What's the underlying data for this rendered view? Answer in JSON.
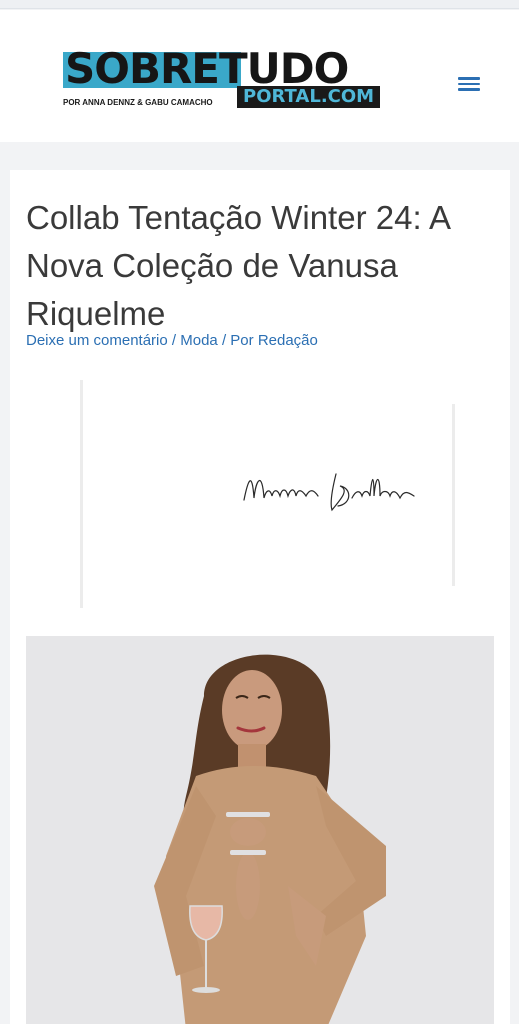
{
  "header": {
    "logo_word": "SOBRETUDO",
    "logo_portal": "PORTAL.COM",
    "logo_byline": "POR ANNA DENNZ & GABU CAMACHO",
    "menu_icon": "hamburger-menu-icon"
  },
  "article": {
    "title": "Collab Tentação Winter 24: A Nova Coleção de Vanusa Riquelme",
    "meta": {
      "comment_link": "Deixe um comentário",
      "separator": "/",
      "category": "Moda",
      "author_prefix": "Por",
      "author": "Redação"
    },
    "signature_text": "Maristela Brittes"
  },
  "colors": {
    "accent": "#2b6fb3",
    "logo_cyan": "#3aa8c9",
    "title_text": "#3a3a3a"
  }
}
